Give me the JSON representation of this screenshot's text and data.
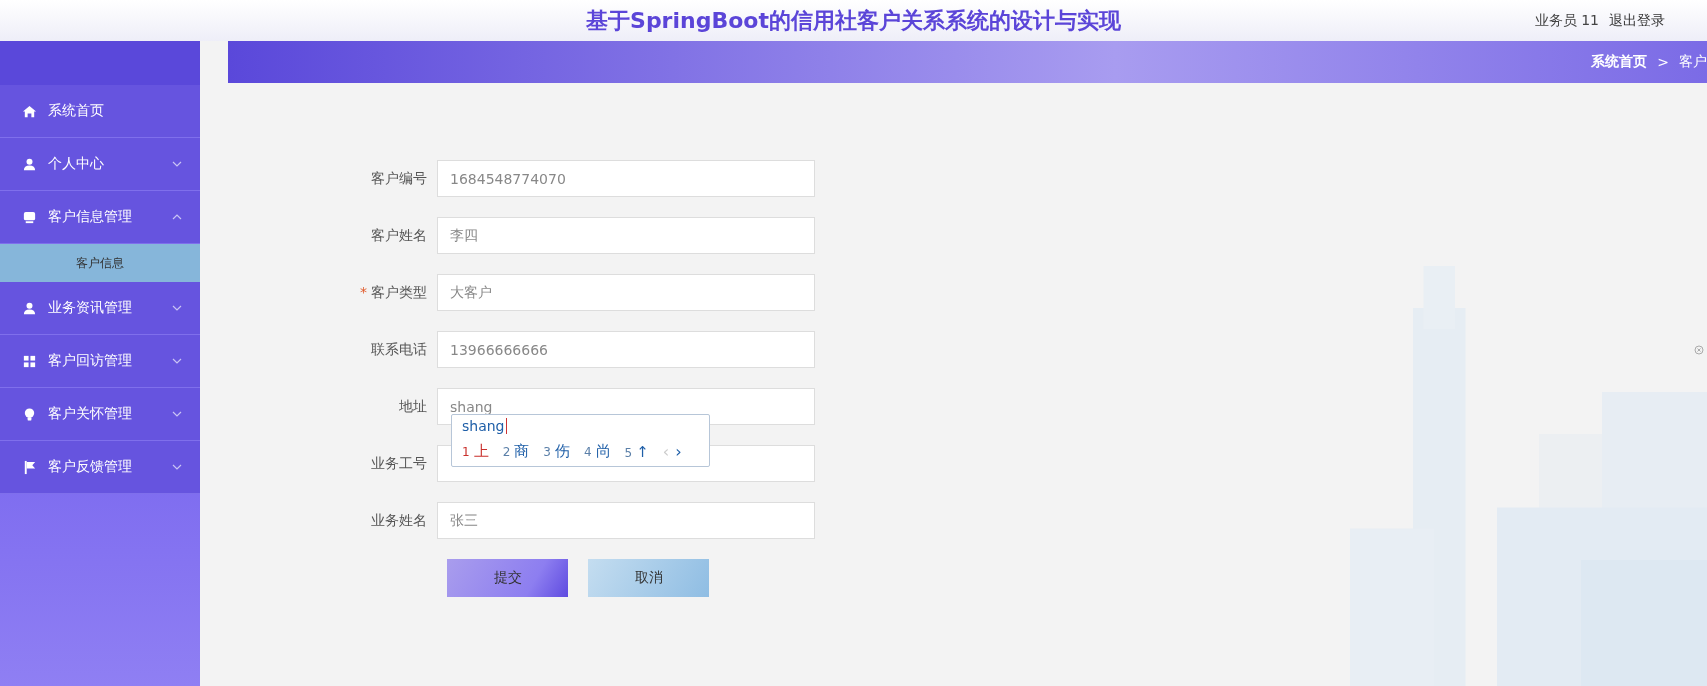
{
  "header": {
    "title": "基于SpringBoot的信用社客户关系系统的设计与实现",
    "user": "业务员 11",
    "logout": "退出登录"
  },
  "sidebar": {
    "items": [
      {
        "label": "系统首页"
      },
      {
        "label": "个人中心",
        "expanded": false
      },
      {
        "label": "客户信息管理",
        "expanded": true,
        "children": [
          {
            "label": "客户信息",
            "selected": true
          }
        ]
      },
      {
        "label": "业务资讯管理",
        "expanded": false
      },
      {
        "label": "客户回访管理",
        "expanded": false
      },
      {
        "label": "客户关怀管理",
        "expanded": false
      },
      {
        "label": "客户反馈管理",
        "expanded": false
      }
    ]
  },
  "breadcrumb": [
    "系统首页",
    ">",
    "客户"
  ],
  "form": {
    "fields": [
      {
        "label": "客户编号",
        "value": "1684548774070"
      },
      {
        "label": "客户姓名",
        "value": "李四"
      },
      {
        "label": "客户类型",
        "value": "大客户",
        "required_marker": "*"
      },
      {
        "label": "联系电话",
        "value": "13966666666"
      },
      {
        "label": "地址",
        "value": "shang"
      },
      {
        "label": "业务工号"
      },
      {
        "label": "业务姓名",
        "value": "张三"
      }
    ],
    "buttons": [
      {
        "label": "提交",
        "kind": "primary"
      },
      {
        "label": "取消",
        "kind": "secondary"
      }
    ]
  },
  "ime": {
    "composition": "shang",
    "candidates": [
      {
        "index": "1",
        "text": "上",
        "selected": true
      },
      {
        "index": "2",
        "text": "商",
        "selected": false
      },
      {
        "index": "3",
        "text": "伤",
        "selected": false
      },
      {
        "index": "4",
        "text": "尚",
        "selected": false
      },
      {
        "index": "5",
        "text": "↑",
        "selected": false
      }
    ],
    "prev": {
      "label": "‹",
      "disabled": true
    },
    "next": {
      "label": "›",
      "disabled": false
    }
  }
}
